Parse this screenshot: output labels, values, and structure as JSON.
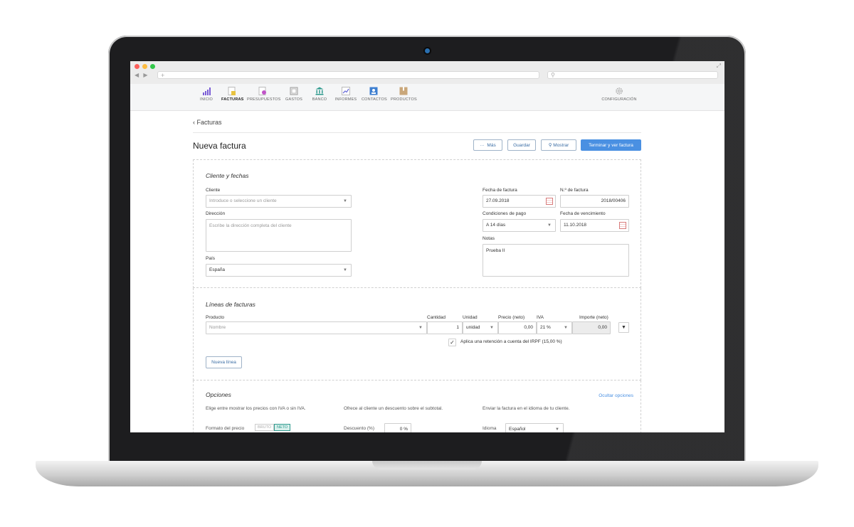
{
  "browser": {
    "nav_buttons": "◀ ▶",
    "new_tab": "+",
    "search_icon": "⚲",
    "expand_icon": "⤢"
  },
  "appnav": {
    "items": [
      {
        "label": "INICIO",
        "icon": "bar-chart-icon",
        "color": "#7a5cd6"
      },
      {
        "label": "FACTURAS",
        "icon": "invoice-icon",
        "color": "#e8c341"
      },
      {
        "label": "PRESUPUESTOS",
        "icon": "quote-icon",
        "color": "#c054c8"
      },
      {
        "label": "GASTOS",
        "icon": "expenses-icon",
        "color": "#9a9a9a"
      },
      {
        "label": "BANCO",
        "icon": "bank-icon",
        "color": "#2f9a8e"
      },
      {
        "label": "INFORMES",
        "icon": "reports-icon",
        "color": "#6c6fd8"
      },
      {
        "label": "CONTACTOS",
        "icon": "contacts-icon",
        "color": "#3d7fd0"
      },
      {
        "label": "PRODUCTOS",
        "icon": "products-icon",
        "color": "#c9a77a"
      }
    ],
    "active": "FACTURAS",
    "settings_label": "CONFIGURACIÓN"
  },
  "breadcrumb": {
    "back_label": "Facturas"
  },
  "page": {
    "title": "Nueva factura"
  },
  "toolbar": {
    "more_label": "Más",
    "more_icon": "···",
    "save_label": "Guardar",
    "show_label": "Mostrar",
    "finish_label": "Terminar y ver factura"
  },
  "client_section": {
    "title": "Cliente y fechas",
    "client_label": "Cliente",
    "client_placeholder": "Introduce o seleccione un cliente",
    "address_label": "Dirección",
    "address_placeholder": "Escribe la dirección completa del cliente",
    "country_label": "País",
    "country_value": "España",
    "invoice_date_label": "Fecha de factura",
    "invoice_date_value": "27.09.2018",
    "invoice_number_label": "N.º de factura",
    "invoice_number_value": "2018/00406",
    "payment_terms_label": "Condiciones de pago",
    "payment_terms_value": "A 14 días",
    "due_date_label": "Fecha de vencimiento",
    "due_date_value": "11.10.2018",
    "notes_label": "Notas",
    "notes_value": "Prueba II"
  },
  "lines_section": {
    "title": "Líneas de facturas",
    "columns": {
      "product": "Producto",
      "quantity": "Cantidad",
      "unit": "Unidad",
      "price": "Precio (neto)",
      "vat": "IVA",
      "amount": "Importe (neto)"
    },
    "row": {
      "product_placeholder": "Nombre",
      "quantity": "1",
      "unit": "unidad",
      "price": "0,00",
      "vat": "21 %",
      "amount": "0,00"
    },
    "irpf_label": "Aplica una retención a cuenta del IRPF (15,00 %)",
    "irpf_checked": true,
    "new_line_label": "Nueva línea"
  },
  "options_section": {
    "title": "Opciones",
    "hide_link": "Ocultar opciones",
    "price_desc": "Elige entre mostrar los precios con IVA o sin IVA.",
    "discount_desc": "Ofrece al cliente un descuento sobre el subtotal.",
    "language_desc": "Enviar la factura en el idioma de tu cliente.",
    "price_format_label": "Formato del precio",
    "price_option_gross": "BRUTO",
    "price_option_net": "NETO",
    "discount_label": "Descuento (%)",
    "discount_value": "0 %",
    "language_label": "Idioma",
    "language_value": "Español"
  }
}
